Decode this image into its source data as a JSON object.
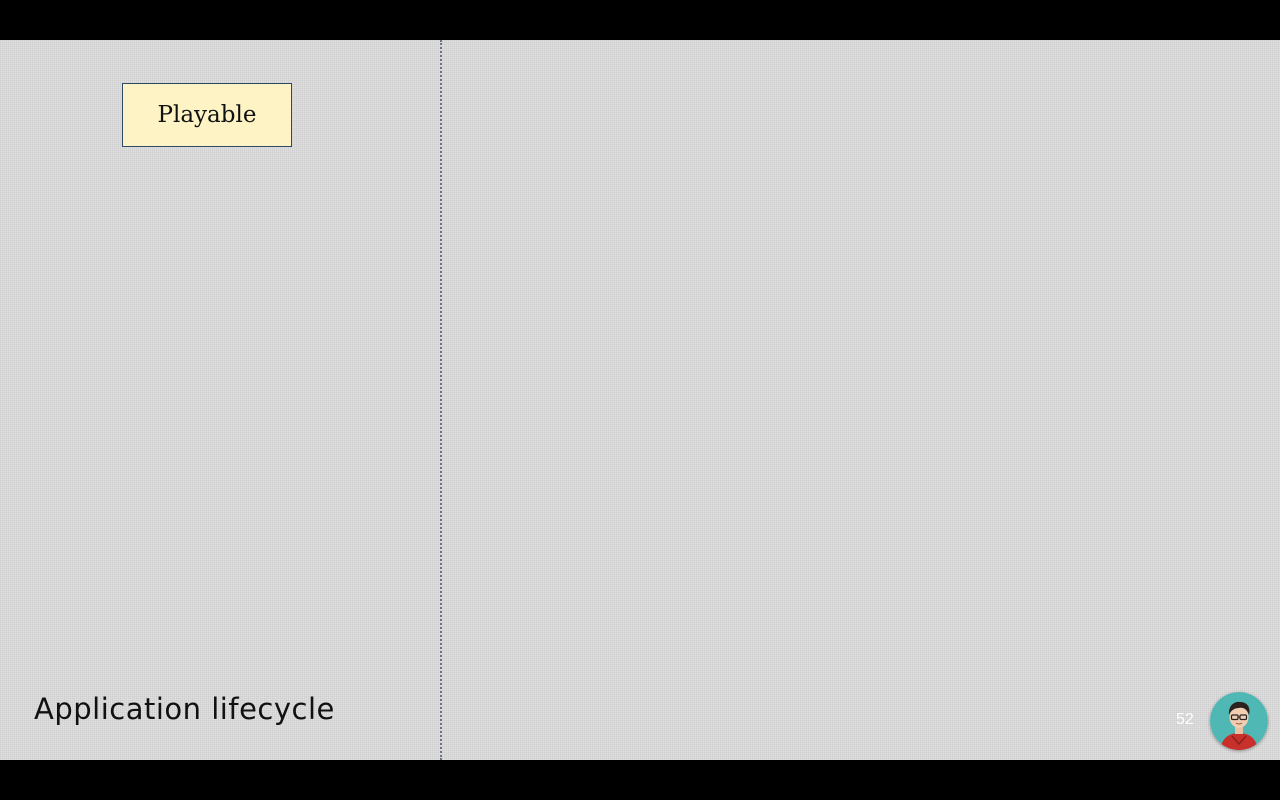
{
  "slide": {
    "title": "Application lifecycle",
    "page_number": "52",
    "state_box_label": "Playable"
  },
  "colors": {
    "slide_background": "#d9d9d9",
    "box_fill": "#fdf3c4",
    "box_border": "#2f4a66",
    "divider": "#6b7391",
    "avatar_background": "#4fb8b4"
  },
  "icons": {
    "avatar": "presenter-avatar-icon"
  }
}
